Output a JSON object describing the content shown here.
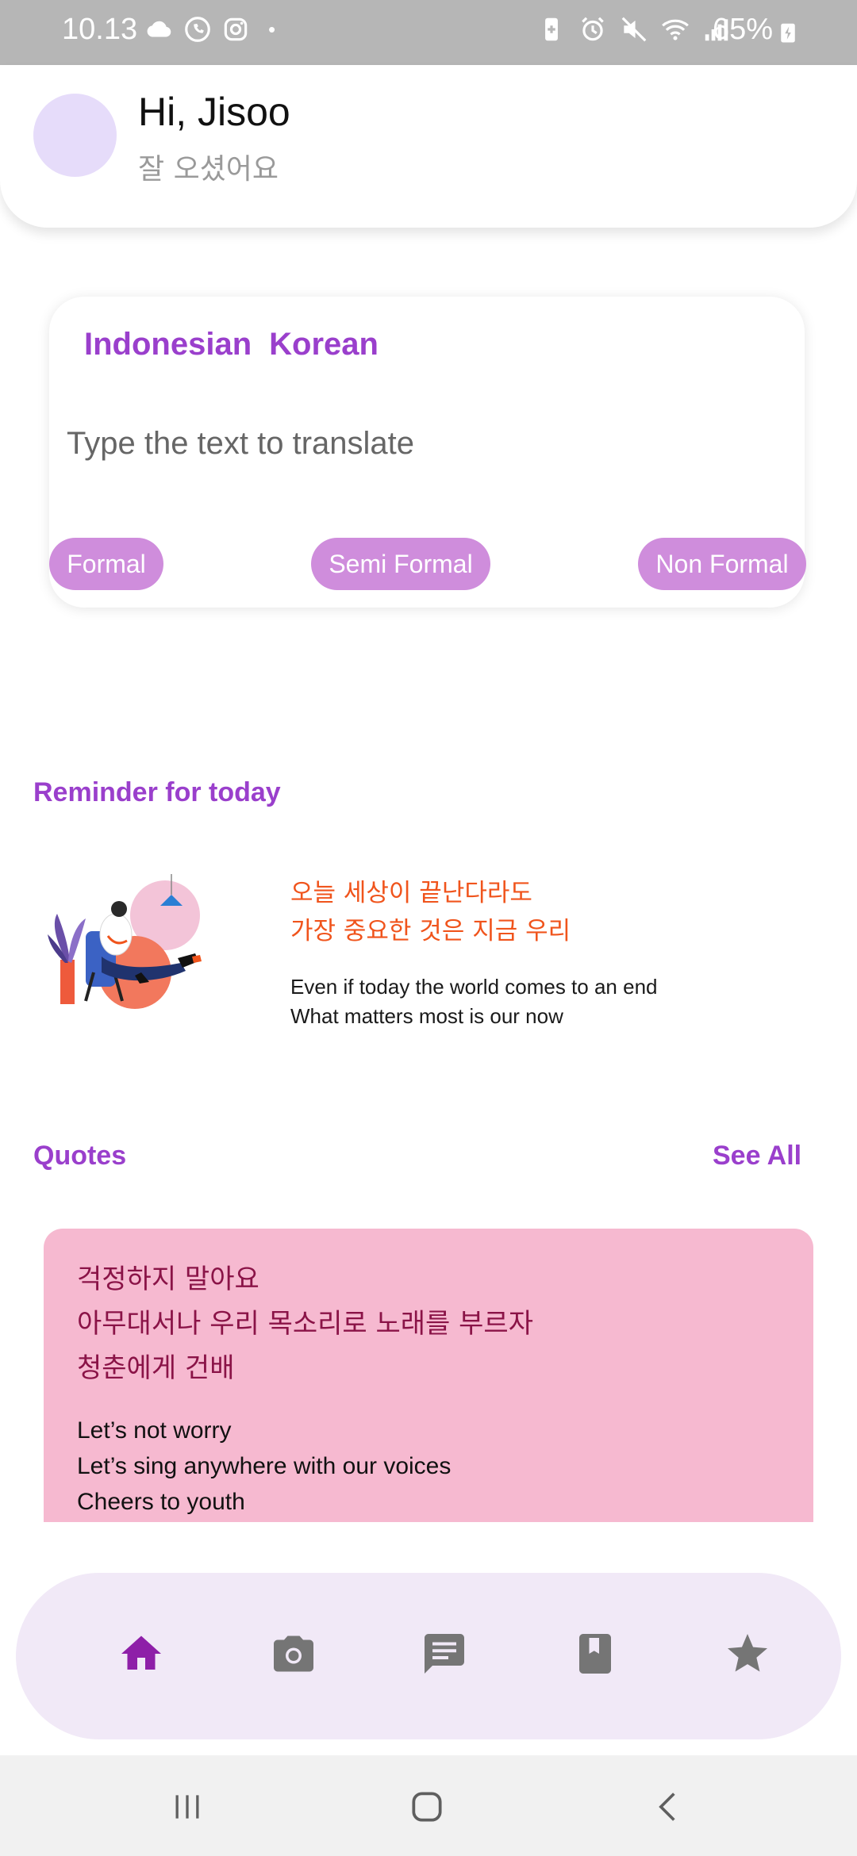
{
  "status_bar": {
    "time": "10.13",
    "dot": "•",
    "battery": "65%",
    "left_icons": [
      "cloud-icon",
      "whatsapp-icon",
      "instagram-icon"
    ],
    "right_icons": [
      "battery-saver-icon",
      "alarm-icon",
      "mute-icon",
      "wifi-icon",
      "signal-icon",
      "charging-icon"
    ]
  },
  "header": {
    "greeting": "Hi, Jisoo",
    "subtitle": "잘 오셨어요"
  },
  "translator": {
    "source_lang": "Indonesian",
    "target_lang": "Korean",
    "placeholder": "Type the text to translate",
    "chips": [
      "Formal",
      "Semi Formal",
      "Non Formal"
    ]
  },
  "reminder": {
    "title": "Reminder for today",
    "korean_line1": "오늘 세상이 끝난다라도",
    "korean_line2": "가장 중요한 것은 지금 우리",
    "english_line1": "Even if today the world comes to an end",
    "english_line2": "What matters most is our now"
  },
  "quotes": {
    "title": "Quotes",
    "see_all": "See All",
    "card": {
      "korean": [
        "걱정하지 말아요",
        "아무대서나 우리 목소리로 노래를 부르자",
        "청춘에게 건배"
      ],
      "english": [
        "Let’s not worry",
        "Let’s sing anywhere with our voices",
        "Cheers to youth"
      ]
    }
  },
  "bottom_nav": {
    "active": "home",
    "items": [
      "home-icon",
      "camera-icon",
      "chat-icon",
      "book-icon",
      "star-icon"
    ],
    "active_color": "#8e1fa8",
    "inactive_color": "#757575"
  },
  "colors": {
    "accent": "#9a3fcc",
    "chip": "#cf8ddc",
    "quote_card": "#f6b9d0",
    "korean_reminder": "#f0541c",
    "korean_quote": "#8a1347"
  }
}
